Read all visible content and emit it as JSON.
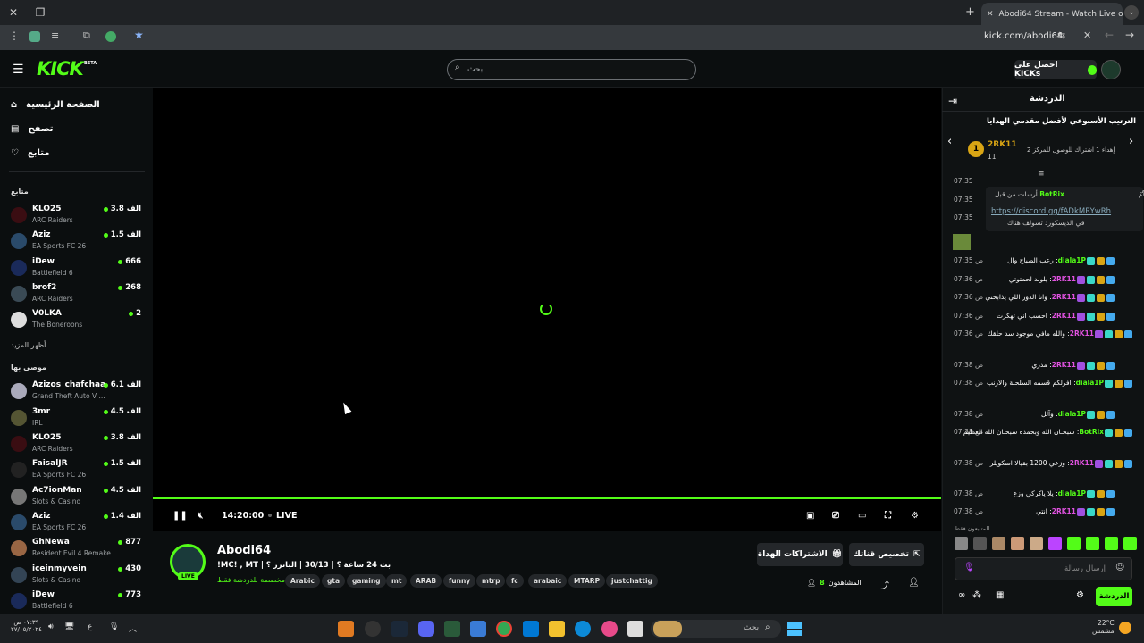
{
  "browser": {
    "tab_title": "Abodi64 Stream - Watch Live o",
    "url": "kick.com/abodi64",
    "new_tab": "+"
  },
  "header": {
    "logo": "KICK",
    "beta": "BETA",
    "search_placeholder": "بحث",
    "get_kicks": "احصل على KICKs"
  },
  "nav": [
    {
      "label": "الصفحة الرئيسية",
      "icon": "home-icon"
    },
    {
      "label": "تصفح",
      "icon": "browse-icon"
    },
    {
      "label": "متابع",
      "icon": "heart-icon"
    }
  ],
  "following_title": "متابع",
  "following": [
    {
      "name": "KLO25",
      "game": "ARC Raiders",
      "viewers": "3.8 الف"
    },
    {
      "name": "Aziz",
      "game": "EA Sports FC 26",
      "viewers": "1.5 الف"
    },
    {
      "name": "iDew",
      "game": "Battlefield 6",
      "viewers": "666"
    },
    {
      "name": "brof2",
      "game": "ARC Raiders",
      "viewers": "268"
    },
    {
      "name": "V0LKA",
      "game": "The Boneroons",
      "viewers": "2"
    }
  ],
  "show_more": "أظهر المزيد",
  "recommended_title": "موصى بها",
  "recommended": [
    {
      "name": "Azizos_chafchaa",
      "game": "Grand Theft Auto V ...",
      "viewers": "6.1 الف"
    },
    {
      "name": "3mr",
      "game": "IRL",
      "viewers": "4.5 الف"
    },
    {
      "name": "KLO25",
      "game": "ARC Raiders",
      "viewers": "3.8 الف"
    },
    {
      "name": "FaisalJR",
      "game": "EA Sports FC 26",
      "viewers": "1.5 الف"
    },
    {
      "name": "Ac7ionMan",
      "game": "Slots & Casino",
      "viewers": "4.5 الف"
    },
    {
      "name": "Aziz",
      "game": "EA Sports FC 26",
      "viewers": "1.4 الف"
    },
    {
      "name": "GhNewa",
      "game": "Resident Evil 4 Remake",
      "viewers": "877"
    },
    {
      "name": "iceinmyvein",
      "game": "Slots & Casino",
      "viewers": "430"
    },
    {
      "name": "iDew",
      "game": "Battlefield 6",
      "viewers": "773"
    }
  ],
  "player": {
    "time": "14:20:00",
    "live": "LIVE"
  },
  "stream": {
    "name": "Abodi64",
    "live_badge": "LIVE",
    "title": "بث 24 ساعة ؟ | 30/13 | البانزر ؟ | MC! , MT!",
    "chat_note": "مخصصة للدردشة فقط",
    "viewers": "8",
    "viewers_label": "المشاهدون",
    "tags": [
      "Arabic",
      "gta",
      "gaming",
      "mt",
      "ARAB",
      "funny",
      "mtrp",
      "fc",
      "arabaic",
      "MTARP",
      "justchattig"
    ],
    "subs_btn": "الاشتراكات الهداة",
    "custom_btn": "تخصيص قناتك"
  },
  "chat": {
    "title": "الدردشة",
    "leaderboard_title": "الترتيب الأسبوعي لأفضل مقدمي الهدايا",
    "top_user": "2RK11",
    "top_count": "11",
    "top_rank": "1",
    "gift_note": "إهداء 1 اشتراك للوصول للمركز 2",
    "pinned_user": "BotRix",
    "pinned_label": "أرسلت من قبل",
    "pinned_link": "https://discord.gg/fADkMRYwRh",
    "pinned_text": "في الديسكورد تسولف هناك",
    "messages": [
      {
        "time": "07:35 ص",
        "user": "diala1P",
        "text": "رعب الصباح وال",
        "color": "#53fc18"
      },
      {
        "time": "07:36 ص",
        "user": "2RK11",
        "text": "يلولد لحمتوتي",
        "color": "#e052e0"
      },
      {
        "time": "07:36 ص",
        "user": "2RK11",
        "text": "وانا الدور اللي يذابحني",
        "color": "#e052e0"
      },
      {
        "time": "07:36 ص",
        "user": "2RK11",
        "text": "احسب اني تهكرت",
        "color": "#e052e0"
      },
      {
        "time": "07:36 ص",
        "user": "2RK11",
        "text": "والله مافي موجود سد حلقك",
        "color": "#e052e0"
      },
      {
        "time": "07:38 ص",
        "user": "2RK11",
        "text": "مدري",
        "color": "#e052e0"
      },
      {
        "time": "07:38 ص",
        "user": "diala1P",
        "text": "افرلكم قسمه السلحنة والارنب",
        "color": "#53fc18"
      },
      {
        "time": "07:38 ص",
        "user": "diala1P",
        "text": "وآلل",
        "color": "#53fc18"
      },
      {
        "time": "07:38 ص",
        "user": "BotRix",
        "text": "سبحـان الله وبحمده سبحـان الله العظيم",
        "color": "#53fc18"
      },
      {
        "time": "07:38 ص",
        "user": "2RK11",
        "text": "وزعي 1200 بقيالا اسكويلر",
        "color": "#e052e0"
      },
      {
        "time": "07:38 ص",
        "user": "diala1P",
        "text": "يلا ياكركي وزع",
        "color": "#53fc18"
      },
      {
        "time": "07:38 ص",
        "user": "2RK11",
        "text": "انتي",
        "color": "#e052e0"
      }
    ],
    "followers_only": "المتابعون فقط",
    "input_placeholder": "إرسال رسالة",
    "send_btn": "الدردشة"
  },
  "taskbar": {
    "search": "بحث",
    "weather": "22°C",
    "weather_desc": "مشمس",
    "time": "٠٧:٣٩ ص",
    "date": "٢٧/٠٥/٢٠٢٤",
    "lang": "ع"
  }
}
